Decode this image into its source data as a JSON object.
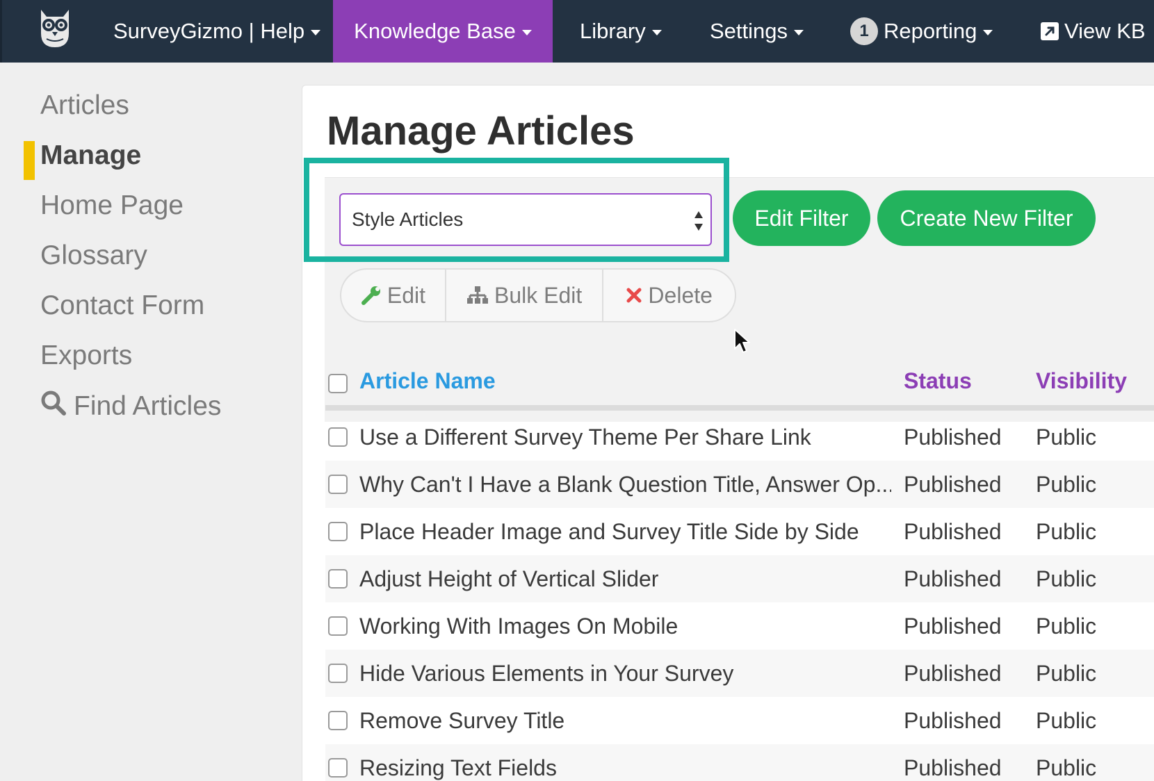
{
  "topnav": {
    "brand_label": "SurveyGizmo | Help",
    "items": [
      {
        "label": "Knowledge Base"
      },
      {
        "label": "Library"
      },
      {
        "label": "Settings"
      },
      {
        "label": "Reporting",
        "badge": "1"
      },
      {
        "label": "View KB"
      }
    ],
    "active_color": "#8c3eb5",
    "bg_color": "#233242"
  },
  "sidebar": {
    "items": [
      {
        "label": "Articles"
      },
      {
        "label": "Manage"
      },
      {
        "label": "Home Page"
      },
      {
        "label": "Glossary"
      },
      {
        "label": "Contact Form"
      },
      {
        "label": "Exports"
      },
      {
        "label": "Find Articles",
        "icon": "search-icon"
      }
    ],
    "active_marker_color": "#f2c200"
  },
  "main": {
    "title": "Manage Articles",
    "filter_select": {
      "value": "Style Articles"
    },
    "edit_filter_label": "Edit Filter",
    "create_filter_label": "Create New Filter",
    "actions": {
      "edit_label": "Edit",
      "bulk_edit_label": "Bulk Edit",
      "delete_label": "Delete"
    },
    "highlight_color": "#1ab3a0"
  },
  "table": {
    "headers": {
      "name": "Article Name",
      "status": "Status",
      "visibility": "Visibility"
    },
    "rows": [
      {
        "name": "Use a Different Survey Theme Per Share Link",
        "status": "Published",
        "visibility": "Public"
      },
      {
        "name": "Why Can't I Have a Blank Question Title, Answer Op...",
        "status": "Published",
        "visibility": "Public"
      },
      {
        "name": "Place Header Image and Survey Title Side by Side",
        "status": "Published",
        "visibility": "Public"
      },
      {
        "name": "Adjust Height of Vertical Slider",
        "status": "Published",
        "visibility": "Public"
      },
      {
        "name": "Working With Images On Mobile",
        "status": "Published",
        "visibility": "Public"
      },
      {
        "name": "Hide Various Elements in Your Survey",
        "status": "Published",
        "visibility": "Public"
      },
      {
        "name": "Remove Survey Title",
        "status": "Published",
        "visibility": "Public"
      },
      {
        "name": "Resizing Text Fields",
        "status": "Published",
        "visibility": "Public"
      }
    ]
  }
}
